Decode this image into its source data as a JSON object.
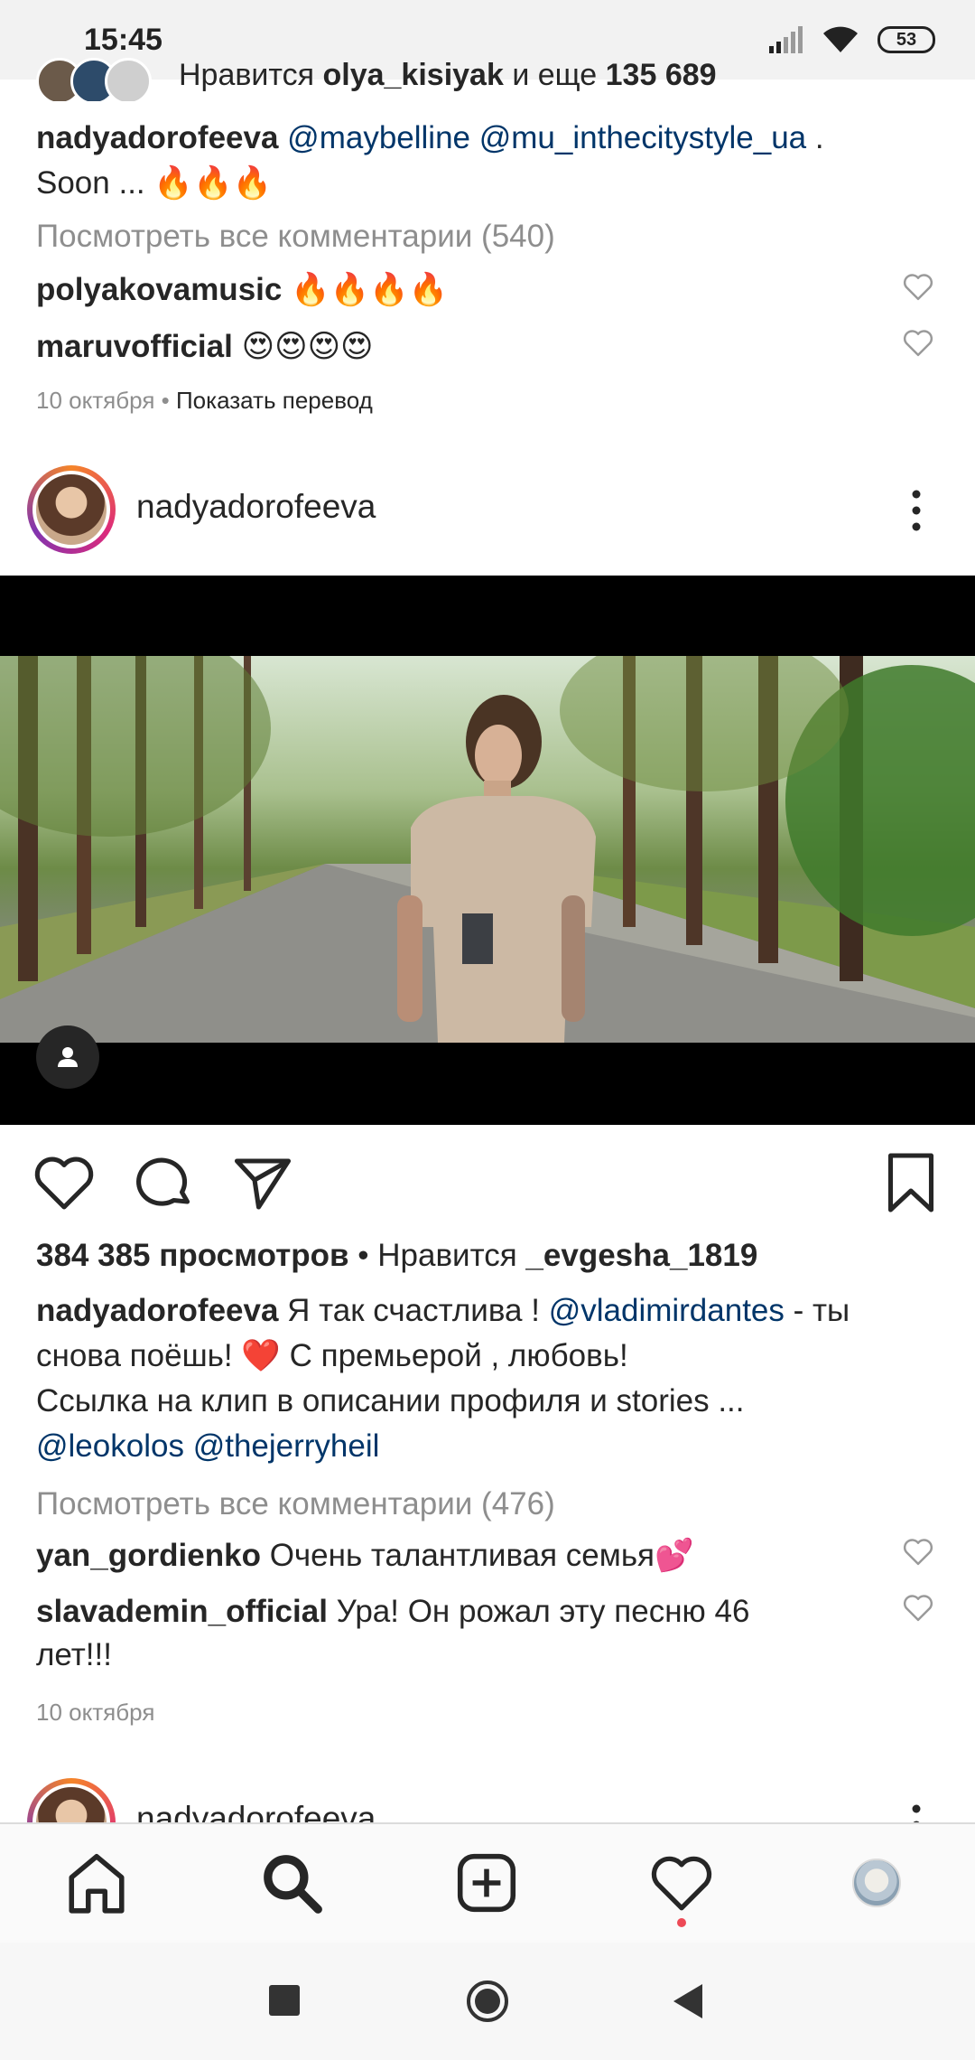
{
  "status_bar": {
    "time": "15:45",
    "battery": "53",
    "icons": [
      "signal-icon",
      "wifi-icon",
      "battery-icon"
    ]
  },
  "previous_post": {
    "likes_prefix": "Нравится",
    "likes_user": "olya_kisiyak",
    "likes_mid": "и еще",
    "likes_count": "135 689",
    "caption_user": "nadyadorofeeva",
    "caption_mention_1": "@maybelline",
    "caption_mention_2": "@mu_inthecitystyle_ua",
    "caption_tail": ".",
    "caption_line2": "Soon ... 🔥🔥🔥",
    "view_all_comments": "Посмотреть все комментарии (540)",
    "comments": [
      {
        "user": "polyakovamusic",
        "text": "🔥🔥🔥🔥"
      },
      {
        "user": "maruvofficial",
        "text": "😍😍😍😍"
      }
    ],
    "date": "10 октября",
    "separator": "•",
    "translate": "Показать перевод"
  },
  "post": {
    "username": "nadyadorofeeva",
    "views": "384 385 просмотров",
    "likes_separator": "•",
    "likes_prefix": "Нравится",
    "likes_user": "_evgesha_1819",
    "caption_user": "nadyadorofeeva",
    "caption_text_1": "Я так счастлива !",
    "caption_mention_1": "@vladimirdantes",
    "caption_text_2": "- ты",
    "caption_line2": "снова поёшь! ❤️ С премьерой , любовь!",
    "caption_line3": "Ссылка на клип в описании профиля и stories ...",
    "caption_mention_2": "@leokolos",
    "caption_mention_3": "@thejerryheil",
    "view_all_comments": "Посмотреть все комментарии (476)",
    "comments": [
      {
        "user": "yan_gordienko",
        "text": "Очень талантливая семья💕"
      },
      {
        "user": "slavademin_official",
        "text": "Ура! Он рожал эту песню 46",
        "text_line2": "лет!!!"
      }
    ],
    "date": "10 октября"
  },
  "next_post": {
    "username": "nadyadorofeeva"
  },
  "bottom_nav": {
    "items": [
      "home-icon",
      "search-icon",
      "add-post-icon",
      "activity-heart-icon",
      "profile-avatar"
    ]
  },
  "colors": {
    "link": "#003569",
    "muted": "#8e8e8e",
    "notification_dot": "#ed4956"
  }
}
